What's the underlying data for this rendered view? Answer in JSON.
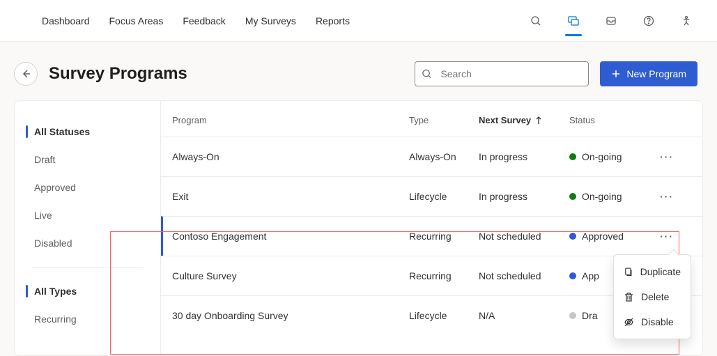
{
  "topnav": {
    "links": [
      "Dashboard",
      "Focus Areas",
      "Feedback",
      "My Surveys",
      "Reports"
    ]
  },
  "header": {
    "title": "Survey Programs",
    "search_placeholder": "Search",
    "new_btn": "New Program"
  },
  "sidebar": {
    "group1": {
      "header": "All Statuses",
      "items": [
        "Draft",
        "Approved",
        "Live",
        "Disabled"
      ]
    },
    "group2": {
      "header": "All Types",
      "items": [
        "Recurring"
      ]
    }
  },
  "table": {
    "columns": {
      "program": "Program",
      "type": "Type",
      "next": "Next Survey",
      "status": "Status"
    },
    "rows": [
      {
        "program": "Always-On",
        "type": "Always-On",
        "next": "In progress",
        "status": "On-going",
        "status_kind": "ongoing"
      },
      {
        "program": "Exit",
        "type": "Lifecycle",
        "next": "In progress",
        "status": "On-going",
        "status_kind": "ongoing"
      },
      {
        "program": "Contoso Engagement",
        "type": "Recurring",
        "next": "Not scheduled",
        "status": "Approved",
        "status_kind": "approved",
        "highlighted": true
      },
      {
        "program": "Culture Survey",
        "type": "Recurring",
        "next": "Not scheduled",
        "status": "App",
        "status_kind": "approved"
      },
      {
        "program": "30 day Onboarding Survey",
        "type": "Lifecycle",
        "next": "N/A",
        "status": "Dra",
        "status_kind": "draft"
      }
    ]
  },
  "dropdown": {
    "items": [
      {
        "label": "Duplicate",
        "icon": "copy"
      },
      {
        "label": "Delete",
        "icon": "trash"
      },
      {
        "label": "Disable",
        "icon": "eye-off"
      }
    ]
  }
}
